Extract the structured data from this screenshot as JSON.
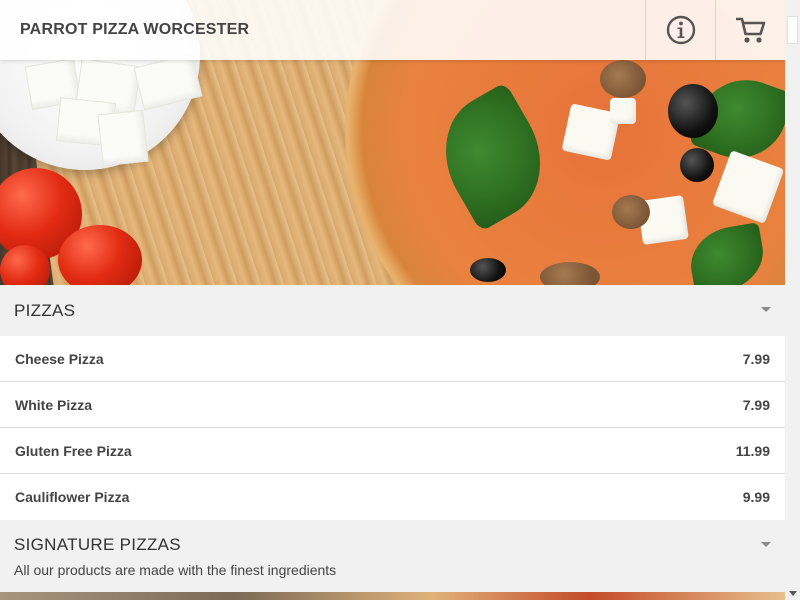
{
  "header": {
    "title": "PARROT PIZZA WORCESTER",
    "info_icon": "info-icon",
    "cart_icon": "cart-icon"
  },
  "menu": {
    "sections": [
      {
        "title": "PIZZAS",
        "items": [
          {
            "name": "Cheese Pizza",
            "price": "7.99"
          },
          {
            "name": "White Pizza",
            "price": "7.99"
          },
          {
            "name": "Gluten Free Pizza",
            "price": "11.99"
          },
          {
            "name": "Cauliflower Pizza",
            "price": "9.99"
          }
        ]
      },
      {
        "title": "SIGNATURE PIZZAS",
        "subtitle": "All our products are made with the finest ingredients"
      }
    ]
  },
  "colors": {
    "text": "#444444",
    "section_bg": "#f1f1f1",
    "item_bg": "#ffffff"
  }
}
